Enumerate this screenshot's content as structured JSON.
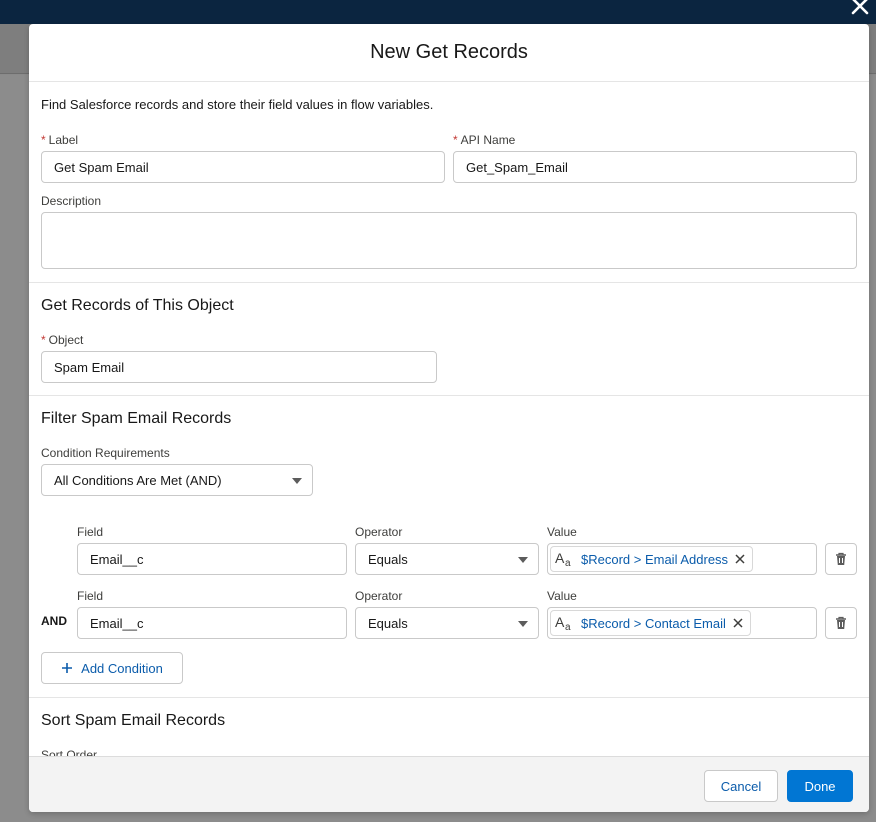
{
  "modal": {
    "title": "New Get Records",
    "intro": "Find Salesforce records and store their field values in flow variables."
  },
  "details": {
    "label_label": "Label",
    "label_value": "Get Spam Email",
    "api_name_label": "API Name",
    "api_name_value": "Get_Spam_Email",
    "description_label": "Description",
    "description_value": ""
  },
  "object_section": {
    "title": "Get Records of This Object",
    "object_label": "Object",
    "object_value": "Spam Email"
  },
  "filter_section": {
    "title": "Filter Spam Email Records",
    "condition_requirements_label": "Condition Requirements",
    "condition_requirements_value": "All Conditions Are Met (AND)",
    "conditions": [
      {
        "prefix": "",
        "field_label": "Field",
        "field_value": "Email__c",
        "operator_label": "Operator",
        "operator_value": "Equals",
        "value_label": "Value",
        "value_pill": "$Record > Email Address"
      },
      {
        "prefix": "AND",
        "field_label": "Field",
        "field_value": "Email__c",
        "operator_label": "Operator",
        "operator_value": "Equals",
        "value_label": "Value",
        "value_pill": "$Record > Contact Email"
      }
    ],
    "add_condition_label": "Add Condition"
  },
  "sort_section": {
    "title": "Sort Spam Email Records",
    "sort_order_label": "Sort Order"
  },
  "footer": {
    "cancel_label": "Cancel",
    "done_label": "Done"
  },
  "icons": {
    "close": "close-icon",
    "text-type": "text-type-icon",
    "pill-remove": "close-icon",
    "delete": "trash-icon",
    "add": "plus-icon",
    "dropdown": "chevron-down-icon"
  },
  "colors": {
    "brand": "#0176d3",
    "link": "#0b5cab",
    "required": "#c23934",
    "header_bar": "#0b2540"
  }
}
